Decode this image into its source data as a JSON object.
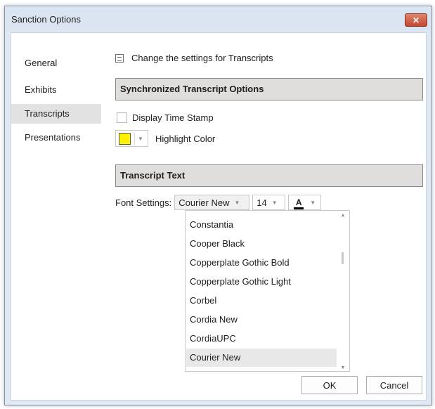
{
  "window": {
    "title": "Sanction Options",
    "close_symbol": "✕"
  },
  "nav": {
    "items": [
      {
        "label": "General"
      },
      {
        "label": "Exhibits"
      },
      {
        "label": "Transcripts",
        "selected": true
      },
      {
        "label": "Presentations"
      }
    ]
  },
  "heading": {
    "text": "Change the settings for Transcripts"
  },
  "sync_section": {
    "title": "Synchronized Transcript Options",
    "display_timestamp": {
      "label": "Display Time Stamp",
      "checked": false
    },
    "highlight": {
      "label": "Highlight Color",
      "color": "#fff200"
    }
  },
  "text_section": {
    "title": "Transcript Text",
    "font_settings_label": "Font Settings:",
    "font_family": "Courier New",
    "font_size": "14",
    "font_color_letter": "A",
    "font_color": "#000000"
  },
  "font_dropdown": {
    "options": [
      "Constantia",
      "Cooper Black",
      "Copperplate Gothic Bold",
      "Copperplate Gothic Light",
      "Corbel",
      "Cordia New",
      "CordiaUPC",
      "Courier New"
    ],
    "selected": "Courier New"
  },
  "buttons": {
    "ok": "OK",
    "cancel": "Cancel"
  }
}
